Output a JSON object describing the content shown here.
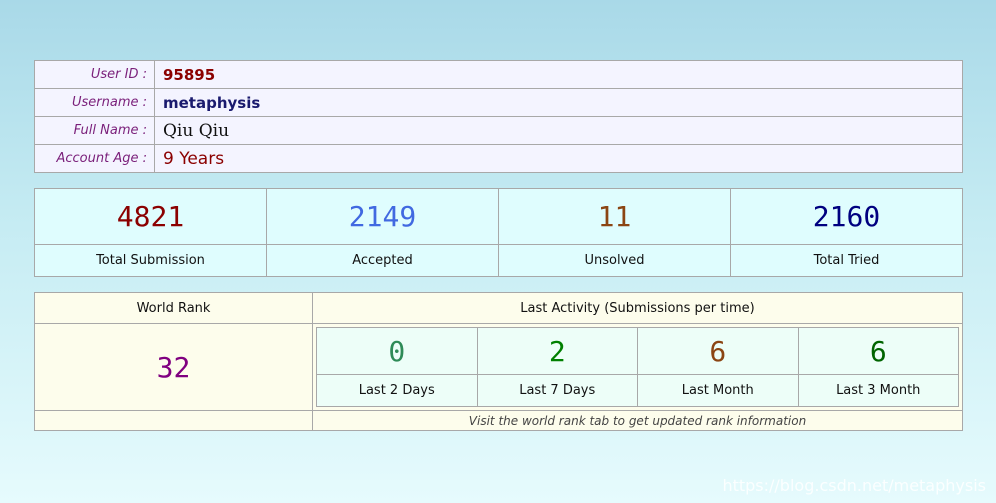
{
  "profile": {
    "rows": [
      {
        "label": "User ID :",
        "value": "95895"
      },
      {
        "label": "Username :",
        "value": "metaphysis"
      },
      {
        "label": "Full Name :",
        "value": "Qiu Qiu"
      },
      {
        "label": "Account Age :",
        "value": "9 Years"
      }
    ]
  },
  "stats": [
    {
      "value": "4821",
      "caption": "Total Submission",
      "color": "#8b0000"
    },
    {
      "value": "2149",
      "caption": "Accepted",
      "color": "#4169e1"
    },
    {
      "value": "11",
      "caption": "Unsolved",
      "color": "#8b4513"
    },
    {
      "value": "2160",
      "caption": "Total Tried",
      "color": "#000080"
    }
  ],
  "rank": {
    "header": "World Rank",
    "value": "32",
    "color": "#800080"
  },
  "activity": {
    "header": "Last Activity (Submissions per time)",
    "items": [
      {
        "value": "0",
        "caption": "Last 2 Days",
        "color": "#2e8b57"
      },
      {
        "value": "2",
        "caption": "Last 7 Days",
        "color": "#008000"
      },
      {
        "value": "6",
        "caption": "Last Month",
        "color": "#8b4513"
      },
      {
        "value": "6",
        "caption": "Last 3 Month",
        "color": "#006400"
      }
    ],
    "note": "Visit the world rank tab to get updated rank information"
  },
  "watermark": "https://blog.csdn.net/metaphysis"
}
